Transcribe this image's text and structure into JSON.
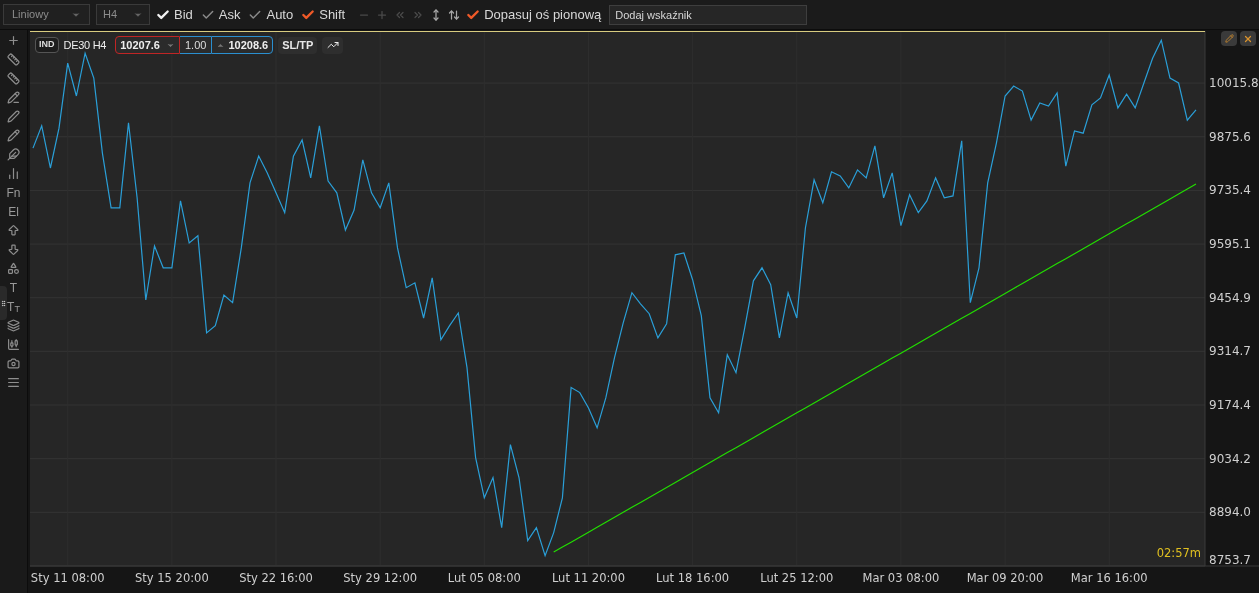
{
  "toolbar": {
    "chart_type": {
      "value": "Liniowy"
    },
    "interval": {
      "value": "H4"
    },
    "toggles": [
      {
        "label": "Bid",
        "checked": true,
        "color": "#f2f2f2"
      },
      {
        "label": "Ask",
        "checked": false,
        "color": "#8a8a8a"
      },
      {
        "label": "Auto",
        "checked": false,
        "color": "#8a8a8a"
      },
      {
        "label": "Shift",
        "checked": true,
        "color": "#f05a28"
      }
    ],
    "nav_buttons": [
      {
        "kind": "minus",
        "disabled": true
      },
      {
        "kind": "plus",
        "disabled": true
      },
      {
        "kind": "rewind",
        "disabled": true
      },
      {
        "kind": "forward",
        "disabled": true
      },
      {
        "kind": "stretch",
        "disabled": false
      },
      {
        "kind": "expand",
        "disabled": false
      }
    ],
    "fit_axis": {
      "label": "Dopasuj oś pionową",
      "checked": true,
      "color": "#f05a28"
    },
    "indicator_search": {
      "placeholder": "Dodaj wskaźnik"
    }
  },
  "side_tools": [
    {
      "kind": "plus"
    },
    {
      "kind": "ruler"
    },
    {
      "kind": "rulers"
    },
    {
      "kind": "line-pen"
    },
    {
      "kind": "pencil-line"
    },
    {
      "kind": "pencil"
    },
    {
      "kind": "feather"
    },
    {
      "kind": "bars"
    },
    {
      "kind": "text",
      "label": "Fn"
    },
    {
      "kind": "text",
      "label": "El"
    },
    {
      "kind": "up"
    },
    {
      "kind": "down"
    },
    {
      "kind": "shapes"
    },
    {
      "kind": "text",
      "label": "T"
    },
    {
      "kind": "text",
      "label": "T$_{T}$"
    },
    {
      "kind": "layers"
    },
    {
      "kind": "candles"
    },
    {
      "kind": "camera"
    },
    {
      "kind": "menu"
    }
  ],
  "chart": {
    "type_badge": "IND",
    "symbol": "DE30 H4",
    "sell_price": "10207.6",
    "volume": "1.00",
    "buy_price": "10208.6",
    "sltp": "SL/TP",
    "timer": "02:57m",
    "chart_data": {
      "type": "line",
      "ylim": [
        8753.7,
        10152
      ],
      "grid": true,
      "yticks": [
        {
          "value": 8753.7,
          "label": "8753.7"
        },
        {
          "value": 8894.0,
          "label": "8894.0"
        },
        {
          "value": 9034.2,
          "label": "9034.2"
        },
        {
          "value": 9174.4,
          "label": "9174.4"
        },
        {
          "value": 9314.7,
          "label": "9314.7"
        },
        {
          "value": 9454.9,
          "label": "9454.9"
        },
        {
          "value": 9595.1,
          "label": "9595.1"
        },
        {
          "value": 9735.4,
          "label": "9735.4"
        },
        {
          "value": 9875.6,
          "label": "9875.6"
        },
        {
          "value": 10015.8,
          "label": "10015.8"
        }
      ],
      "categories": [
        null,
        null,
        null,
        null,
        "Sty 11 08:00",
        null,
        null,
        null,
        null,
        null,
        null,
        null,
        null,
        null,
        null,
        null,
        "Sty 15 20:00",
        null,
        null,
        null,
        null,
        null,
        null,
        null,
        null,
        null,
        null,
        null,
        "Sty 22 16:00",
        null,
        null,
        null,
        null,
        null,
        null,
        null,
        null,
        null,
        null,
        null,
        "Sty 29 12:00",
        null,
        null,
        null,
        null,
        null,
        null,
        null,
        null,
        null,
        null,
        null,
        "Lut 05 08:00",
        null,
        null,
        null,
        null,
        null,
        null,
        null,
        null,
        null,
        null,
        null,
        "Lut 11 20:00",
        null,
        null,
        null,
        null,
        null,
        null,
        null,
        null,
        null,
        null,
        null,
        "Lut 18 16:00",
        null,
        null,
        null,
        null,
        null,
        null,
        null,
        null,
        null,
        null,
        null,
        "Lut 25 12:00",
        null,
        null,
        null,
        null,
        null,
        null,
        null,
        null,
        null,
        null,
        null,
        "Mar 03 08:00",
        null,
        null,
        null,
        null,
        null,
        null,
        null,
        null,
        null,
        null,
        null,
        "Mar 09 20:00",
        null,
        null,
        null,
        null,
        null,
        null,
        null,
        null,
        null,
        null,
        null,
        "Mar 16 16:00",
        null,
        null,
        null,
        null,
        null,
        null,
        null,
        null,
        null,
        null
      ],
      "series": [
        {
          "color": "#2a9fd8",
          "values": [
            9846,
            9904,
            9794,
            9898,
            10068,
            9982,
            10094,
            10029,
            9833,
            9690,
            9690,
            9912,
            9716,
            9449,
            9590,
            9533,
            9533,
            9708,
            9598,
            9617,
            9363,
            9382,
            9462,
            9442,
            9585,
            9755,
            9825,
            9781,
            9729,
            9677,
            9825,
            9867,
            9768,
            9904,
            9760,
            9729,
            9632,
            9684,
            9815,
            9729,
            9690,
            9755,
            9585,
            9481,
            9494,
            9402,
            9507,
            9345,
            9382,
            9415,
            9272,
            9037,
            8932,
            8985,
            8854,
            9071,
            8985,
            8820,
            8854,
            8781,
            8841,
            8932,
            9220,
            9207,
            9167,
            9115,
            9193,
            9298,
            9389,
            9468,
            9439,
            9413,
            9350,
            9387,
            9567,
            9572,
            9502,
            9408,
            9193,
            9154,
            9306,
            9259,
            9376,
            9499,
            9533,
            9489,
            9350,
            9468,
            9402,
            9637,
            9763,
            9703,
            9784,
            9773,
            9742,
            9789,
            9768,
            9852,
            9716,
            9781,
            9643,
            9724,
            9677,
            9708,
            9768,
            9716,
            9721,
            9865,
            9442,
            9533,
            9755,
            9859,
            9982,
            10008,
            9995,
            9919,
            9964,
            9956,
            9990,
            9799,
            9891,
            9885,
            9959,
            9977,
            10037,
            9951,
            9987,
            9951,
            10016,
            10081,
            10128,
            10029,
            10016,
            9919,
            9946
          ]
        },
        {
          "color": "#22dd00",
          "values": [
            null,
            null,
            null,
            null,
            null,
            null,
            null,
            null,
            null,
            null,
            null,
            null,
            null,
            null,
            null,
            null,
            null,
            null,
            null,
            null,
            null,
            null,
            null,
            null,
            null,
            null,
            null,
            null,
            null,
            null,
            null,
            null,
            null,
            null,
            null,
            null,
            null,
            null,
            null,
            null,
            null,
            null,
            null,
            null,
            null,
            null,
            null,
            null,
            null,
            null,
            null,
            null,
            null,
            null,
            null,
            null,
            null,
            null,
            null,
            null,
            8790,
            8803,
            8816,
            8829,
            8842,
            8855,
            8868,
            8881,
            8894,
            8907,
            8920,
            8933,
            8946,
            8959,
            8972,
            8985,
            8998,
            9011,
            9024,
            9037,
            9050,
            9063,
            9076,
            9089,
            9102,
            9115,
            9128,
            9141,
            9154,
            9167,
            9180,
            9193,
            9206,
            9219,
            9232,
            9245,
            9258,
            9271,
            9284,
            9297,
            9310,
            9323,
            9336,
            9349,
            9362,
            9375,
            9388,
            9401,
            9414,
            9427,
            9440,
            9453,
            9466,
            9479,
            9492,
            9505,
            9518,
            9531,
            9544,
            9557,
            9570,
            9583,
            9596,
            9609,
            9622,
            9635,
            9648,
            9661,
            9674,
            9687,
            9700,
            9713,
            9726,
            9739,
            9752
          ]
        }
      ]
    }
  }
}
